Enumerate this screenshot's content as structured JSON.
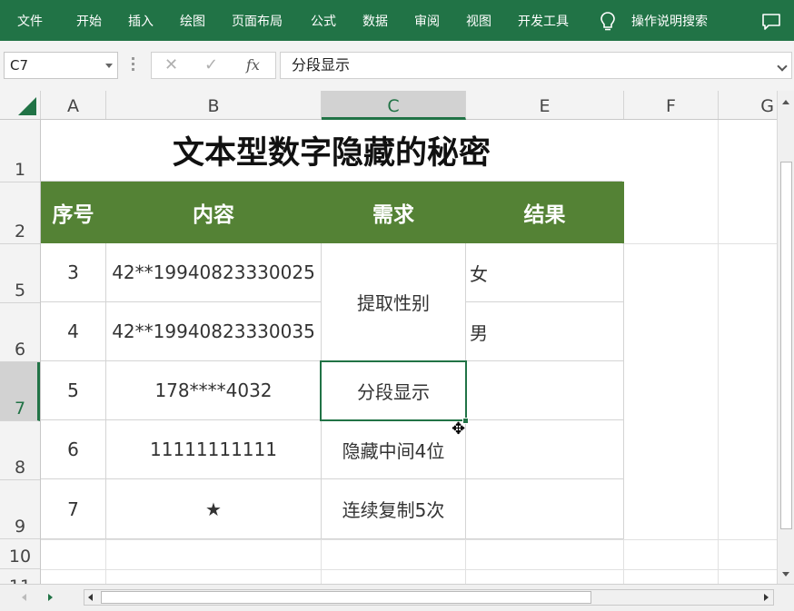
{
  "ribbon": {
    "tabs": [
      "文件",
      "开始",
      "插入",
      "绘图",
      "页面布局",
      "公式",
      "数据",
      "审阅",
      "视图",
      "开发工具"
    ],
    "tell_me": "操作说明搜索",
    "bg_color": "#217346"
  },
  "formula_bar": {
    "name_box": "C7",
    "cancel_glyph": "✕",
    "enter_glyph": "✓",
    "fx_label": "fx",
    "formula": "分段显示"
  },
  "columns": [
    "A",
    "B",
    "C",
    "E",
    "F",
    "G"
  ],
  "selected_column": "C",
  "rows": [
    "1",
    "2",
    "5",
    "6",
    "7",
    "8",
    "9",
    "10",
    "11"
  ],
  "selected_row": "7",
  "sheet": {
    "title": "文本型数字隐藏的秘密",
    "headers": [
      "序号",
      "内容",
      "需求",
      "结果"
    ],
    "header_color": "#548235",
    "data": [
      {
        "seq": "3",
        "content": "42**19940823330025",
        "need": "提取性别",
        "result": "女"
      },
      {
        "seq": "4",
        "content": "42**19940823330035",
        "need": "",
        "result": "男"
      },
      {
        "seq": "5",
        "content": "178****4032",
        "need": "分段显示",
        "result": ""
      },
      {
        "seq": "6",
        "content": "11111111111",
        "need": "隐藏中间4位",
        "result": ""
      },
      {
        "seq": "7",
        "content": "★",
        "need": "连续复制5次",
        "result": ""
      }
    ]
  },
  "cursor_glyph": "✥"
}
